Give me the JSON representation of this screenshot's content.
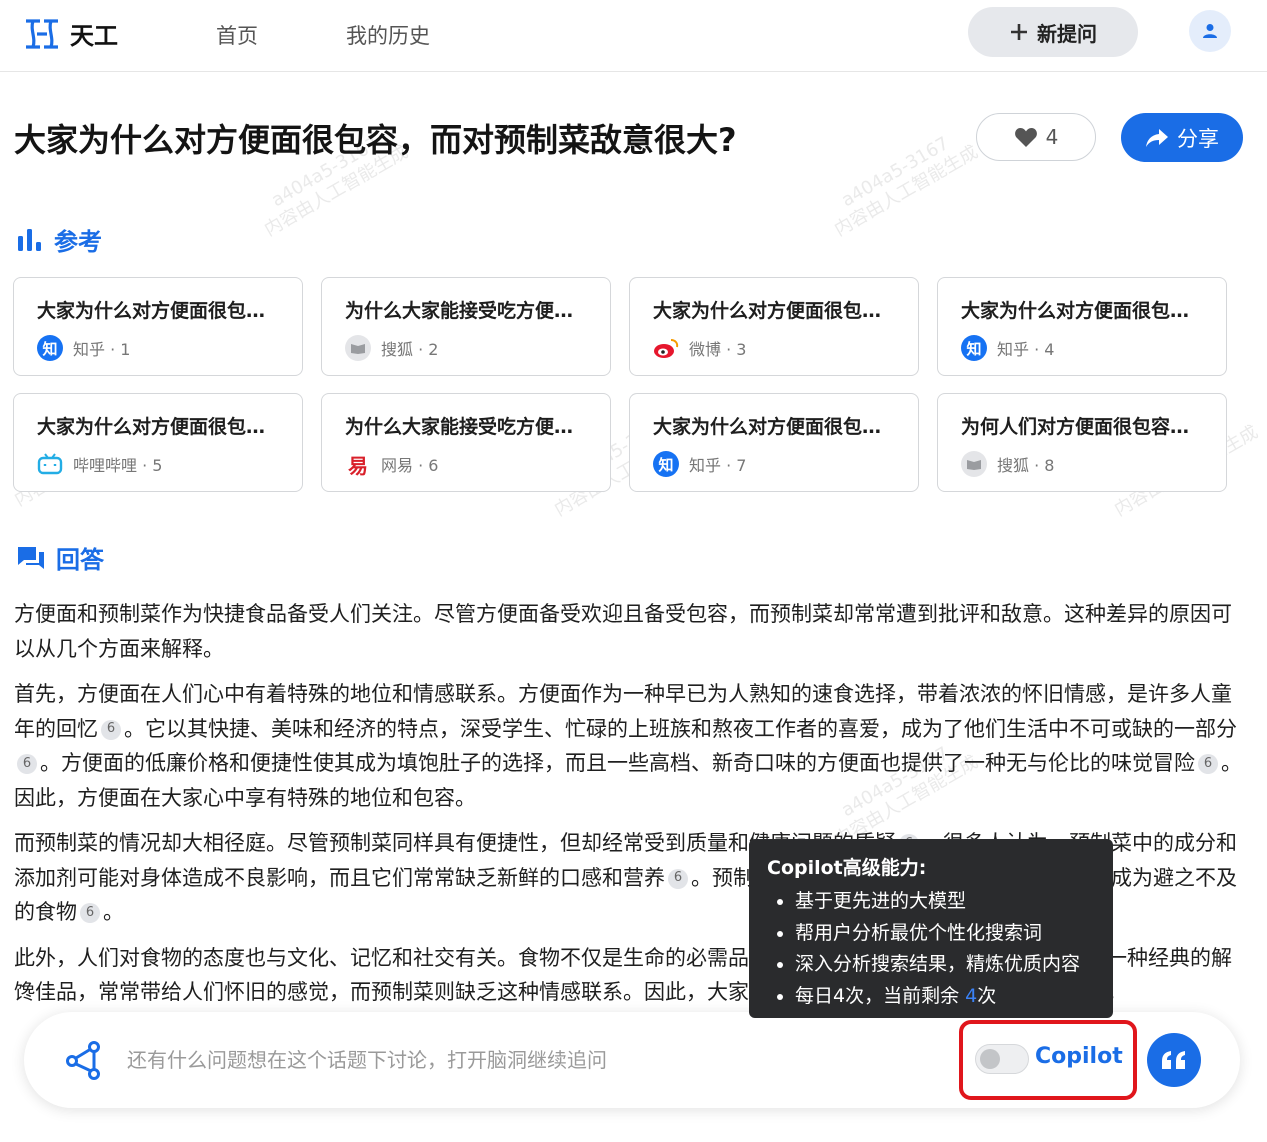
{
  "header": {
    "logo_text": "天工",
    "nav": [
      "首页",
      "我的历史"
    ],
    "new_question": "新提问"
  },
  "question": {
    "title": "大家为什么对方便面很包容，而对预制菜敌意很大?",
    "likes": "4",
    "share": "分享"
  },
  "references": {
    "heading": "参考",
    "items": [
      {
        "title": "大家为什么对方便面很包容，而对预制菜敌意很大?",
        "source": "知乎 · 1",
        "icon": "zhihu-icon",
        "color": "#1672f3"
      },
      {
        "title": "为什么大家能接受吃方便面，却不接受预制菜?",
        "source": "搜狐 · 2",
        "icon": "sohu-icon",
        "color": "#e4e5e8"
      },
      {
        "title": "大家为什么对方便面很包容，而对预制菜敌意很大?",
        "source": "微博 · 3",
        "icon": "weibo-icon",
        "color": "#e6162d"
      },
      {
        "title": "大家为什么对方便面很包容…",
        "source": "知乎 · 4",
        "icon": "zhihu-icon",
        "color": "#1672f3"
      },
      {
        "title": "大家为什么对方便面很包容，而对预制菜敌意很大?",
        "source": "哔哩哔哩 · 5",
        "icon": "bilibili-icon",
        "color": "#23ade5"
      },
      {
        "title": "为什么大家能接受吃方便面，却不接受预制菜?",
        "source": "网易 · 6",
        "icon": "netease-icon",
        "color": "#d9202a"
      },
      {
        "title": "大家为什么对方便面很包容，而对预制菜敌意很大?",
        "source": "知乎 · 7",
        "icon": "zhihu-icon",
        "color": "#1672f3"
      },
      {
        "title": "为何人们对方便面很包容，…",
        "source": "搜狐 · 8",
        "icon": "sohu-icon",
        "color": "#e4e5e8"
      }
    ]
  },
  "answer": {
    "heading": "回答",
    "p1": "方便面和预制菜作为快捷食品备受人们关注。尽管方便面备受欢迎且备受包容，而预制菜却常常遭到批评和敌意。这种差异的原因可以从几个方面来解释。",
    "p2a": "首先，方便面在人们心中有着特殊的地位和情感联系。方便面作为一种早已为人熟知的速食选择，带着浓浓的怀旧情感，是许多人童年的回忆",
    "p2b": "。它以其快捷、美味和经济的特点，深受学生、忙碌的上班族和熬夜工作者的喜爱，成为了他们生活中不可或缺的一部分",
    "p2c": "。方便面的低廉价格和便捷性使其成为填饱肚子的选择，而且一些高档、新奇口味的方便面也提供了一种无与伦比的味觉冒险",
    "p2d": "。因此，方便面在大家心中享有特殊的地位和包容。",
    "p3a": "而预制菜的情况却大相径庭。尽管预制菜同样具有便捷性，但却经常受到质量和健康问题的质疑",
    "p3b": "。很多人认为，预制菜中的成分和添加剂可能对身体造成不良影响，而且它们常常缺乏新鲜的口感和营养",
    "p3c": "。预制菜在公众心目中逐渐沦为备选项，甚至成为避之不及的食物",
    "p3d": "。",
    "p4": "此外，人们对食物的态度也与文化、记忆和社交有关。食物不仅是生命的必需品，也是情感和文化的载体。方便面作为一种经典的解馋佳品，常常带给人们怀旧的感觉，而预制菜则缺乏这种情感联系。因此，大家对方便面很包容，而对预制菜敌意很大。",
    "cite": "6"
  },
  "input": {
    "placeholder": "还有什么问题想在这个话题下讨论，打开脑洞继续追问",
    "copilot_label": "Copilot"
  },
  "tooltip": {
    "title": "Copilot高级能力:",
    "items": [
      "基于更先进的大模型",
      "帮用户分析最优个性化搜索词",
      "深入分析搜索结果，精炼优质内容"
    ],
    "last_prefix": "每日4次，当前剩余 ",
    "remaining": "4",
    "last_suffix": "次"
  },
  "watermark": {
    "line1": "a404a5-3167",
    "line2": "内容由人工智能生成"
  },
  "colors": {
    "accent": "#1a6de6",
    "highlight_border": "#e0161c",
    "tooltip_bg": "#2a2b2d"
  }
}
